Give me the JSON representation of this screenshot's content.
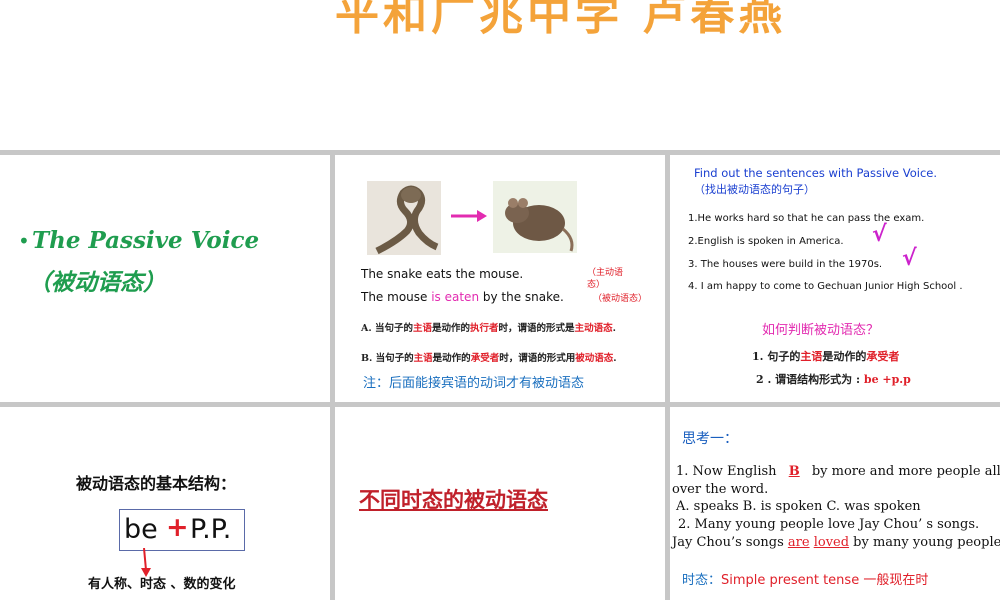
{
  "header": {
    "title": "平和广兆中学 卢春燕"
  },
  "slide1": {
    "bullet": "•",
    "title": "The Passive  Voice",
    "subtitle": "（被动语态）"
  },
  "slide2": {
    "sentence1": "The snake  eats  the mouse.",
    "sentence2_start": "The mouse ",
    "sentence2_mid": "is eaten",
    "sentence2_end": " by the snake.",
    "tag_active": "（主动语态）",
    "tag_passive": "（被动语态）",
    "ruleA_1": "A. 当句子的",
    "ruleA_2": "主语",
    "ruleA_3": "是动作的",
    "ruleA_4": "执行者",
    "ruleA_5": "时，谓语的形式是",
    "ruleA_6": "主动语态",
    "ruleA_7": ".",
    "ruleB_1": "B. 当句子的",
    "ruleB_2": "主语",
    "ruleB_3": "是动作的",
    "ruleB_4": "承受者",
    "ruleB_5": "时，谓语的形式用",
    "ruleB_6": "被动语态",
    "ruleB_7": ".",
    "note": "注：后面能接宾语的动词才有被动语态"
  },
  "slide3": {
    "title": "Find out the sentences with Passive Voice.",
    "subtitle": "（找出被动语态的句子）",
    "sentences": [
      "1.He works hard so that he can pass the exam.",
      "2.English is spoken in America.",
      "3. The houses were build in the 1970s.",
      "4. I am happy to come to Gechuan Junior High School ."
    ],
    "check": "√",
    "question": "如何判断被动语态？",
    "point1_a": "1. 句子的",
    "point1_b": "主语",
    "point1_c": "是动作的",
    "point1_d": "承受者",
    "point2_a": "2 . 谓语结构形式为 : ",
    "point2_b": "be +p.p"
  },
  "slide4": {
    "title": "被动语态的基本结构：",
    "be": "be",
    "plus": "+",
    "pp": "P.P.",
    "note": "有人称、时态 、数的变化"
  },
  "slide5": {
    "title": "不同时态的被动语态"
  },
  "slide6": {
    "title": "思考一：",
    "q1_a": "1. Now English ",
    "q1_blank": "B",
    "q1_b": " by more and more people all",
    "q1_c": "over the word.",
    "options": "A. speaks     B. is spoken    C. was spoken",
    "q2_a": "2. Many young people love Jay Chou’ s songs.",
    "q2_b1": "Jay Chou’s songs ",
    "q2_blank1": "are",
    "q2_blank2": "loved",
    "q2_b2": " by many young people.",
    "tense_label": "时态：",
    "tense_value": "Simple present tense",
    "tense_cn": " 一般现在时"
  },
  "colors": {
    "orange": "#f4a33a",
    "green": "#1f9d4f",
    "red": "#e0202a",
    "magenta": "#e22bb0",
    "blue": "#1a4fbf"
  }
}
